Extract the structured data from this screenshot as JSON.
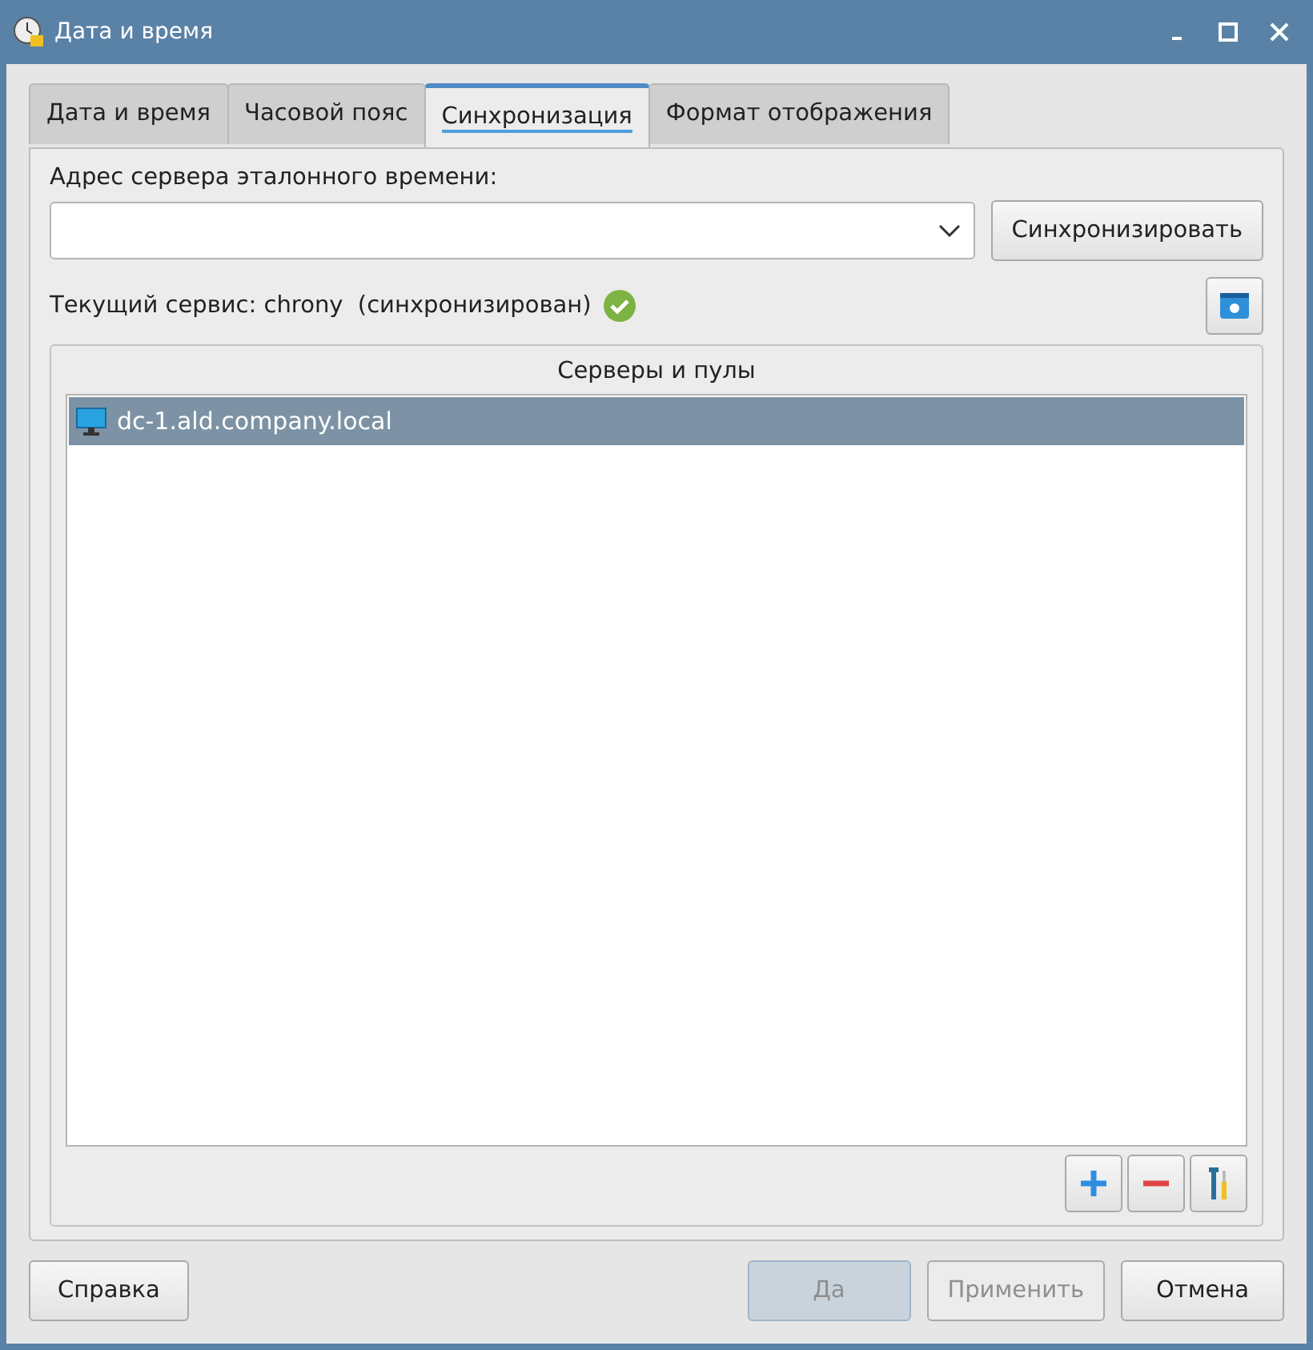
{
  "window": {
    "title": "Дата и время"
  },
  "tabs": [
    {
      "label": "Дата и время",
      "selected": false
    },
    {
      "label": "Часовой пояс",
      "selected": false
    },
    {
      "label": "Синхронизация",
      "selected": true
    },
    {
      "label": "Формат отображения",
      "selected": false
    }
  ],
  "server_label": "Адрес сервера эталонного времени:",
  "sync_button": "Синхронизировать",
  "status": {
    "text": "Текущий сервис: chrony  (синхронизирован)",
    "synced": true
  },
  "servers": {
    "title": "Серверы и пулы",
    "items": [
      {
        "label": "dc-1.ald.company.local",
        "selected": true
      }
    ],
    "tools": [
      {
        "kind": "add"
      },
      {
        "kind": "remove"
      },
      {
        "kind": "tools"
      }
    ]
  },
  "help_button": "Справка",
  "buttons": [
    {
      "label": "Да",
      "disabled": true,
      "default": true
    },
    {
      "label": "Применить",
      "disabled": true,
      "default": false
    },
    {
      "label": "Отмена",
      "disabled": false,
      "default": false
    }
  ]
}
